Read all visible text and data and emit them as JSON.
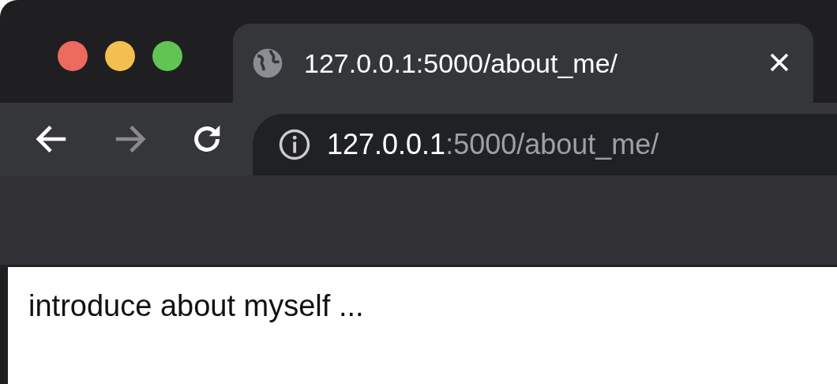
{
  "tabs": [
    {
      "title": "127.0.0.1:5000/about_me/",
      "selected": true
    }
  ],
  "toolbar": {
    "back_disabled": false,
    "forward_disabled": true
  },
  "address_bar": {
    "host": "127.0.0.1",
    "rest": ":5000/about_me/"
  },
  "page": {
    "text": "introduce about myself ..."
  }
}
